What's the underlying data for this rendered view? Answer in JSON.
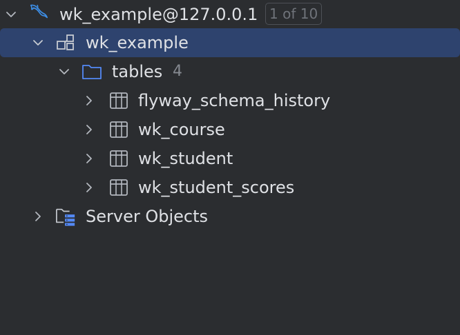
{
  "tree": {
    "connection": {
      "label": "wk_example@127.0.0.1",
      "badge": "1 of 10",
      "icon": "mysql-dolphin-icon"
    },
    "schema": {
      "label": "wk_example",
      "icon": "schema-icon"
    },
    "tables_folder": {
      "label": "tables",
      "count": "4",
      "icon": "folder-icon"
    },
    "tables": [
      {
        "label": "flyway_schema_history",
        "icon": "table-icon"
      },
      {
        "label": "wk_course",
        "icon": "table-icon"
      },
      {
        "label": "wk_student",
        "icon": "table-icon"
      },
      {
        "label": "wk_student_scores",
        "icon": "table-icon"
      }
    ],
    "server_objects": {
      "label": "Server Objects",
      "icon": "server-folder-icon"
    }
  },
  "colors": {
    "background": "#2b2d30",
    "selection": "#2e436e",
    "text": "#dfe1e5",
    "muted": "#868a91",
    "accent_blue": "#3d8ee6"
  }
}
